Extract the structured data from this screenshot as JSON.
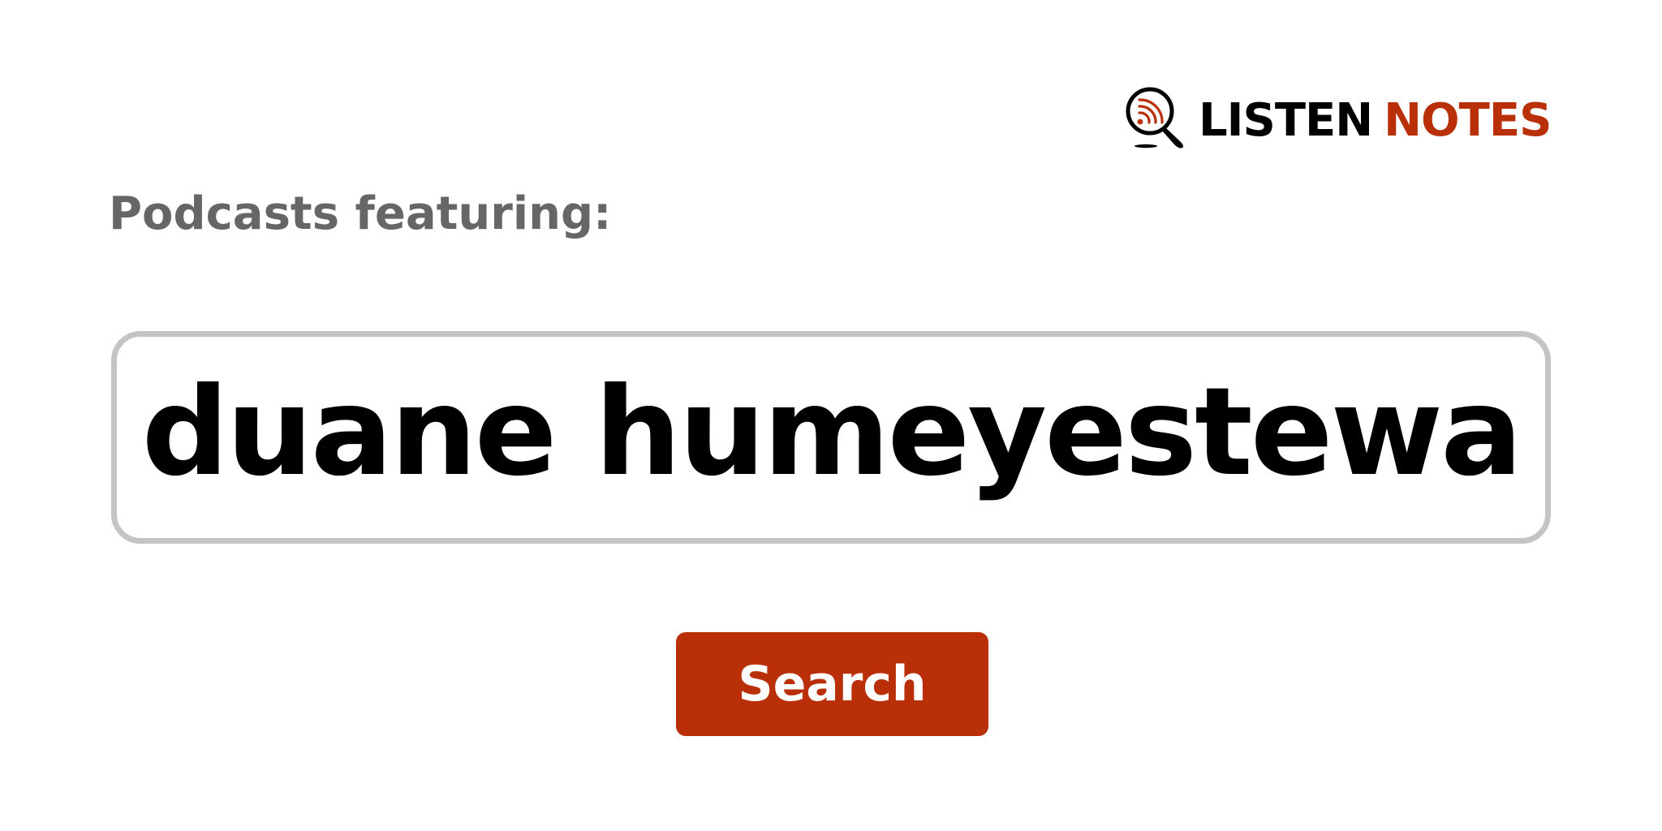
{
  "logo": {
    "icon": "podcast-search-magnifier-icon",
    "word1": "LISTEN",
    "word2": "NOTES"
  },
  "heading": {
    "label": "Podcasts featuring:"
  },
  "search": {
    "value": "duane humeyestewa"
  },
  "button": {
    "label": "Search"
  },
  "colors": {
    "brand": "#b82f08",
    "label_gray": "#666666",
    "border_gray": "#c4c4c4",
    "text": "#000000",
    "background": "#ffffff"
  }
}
